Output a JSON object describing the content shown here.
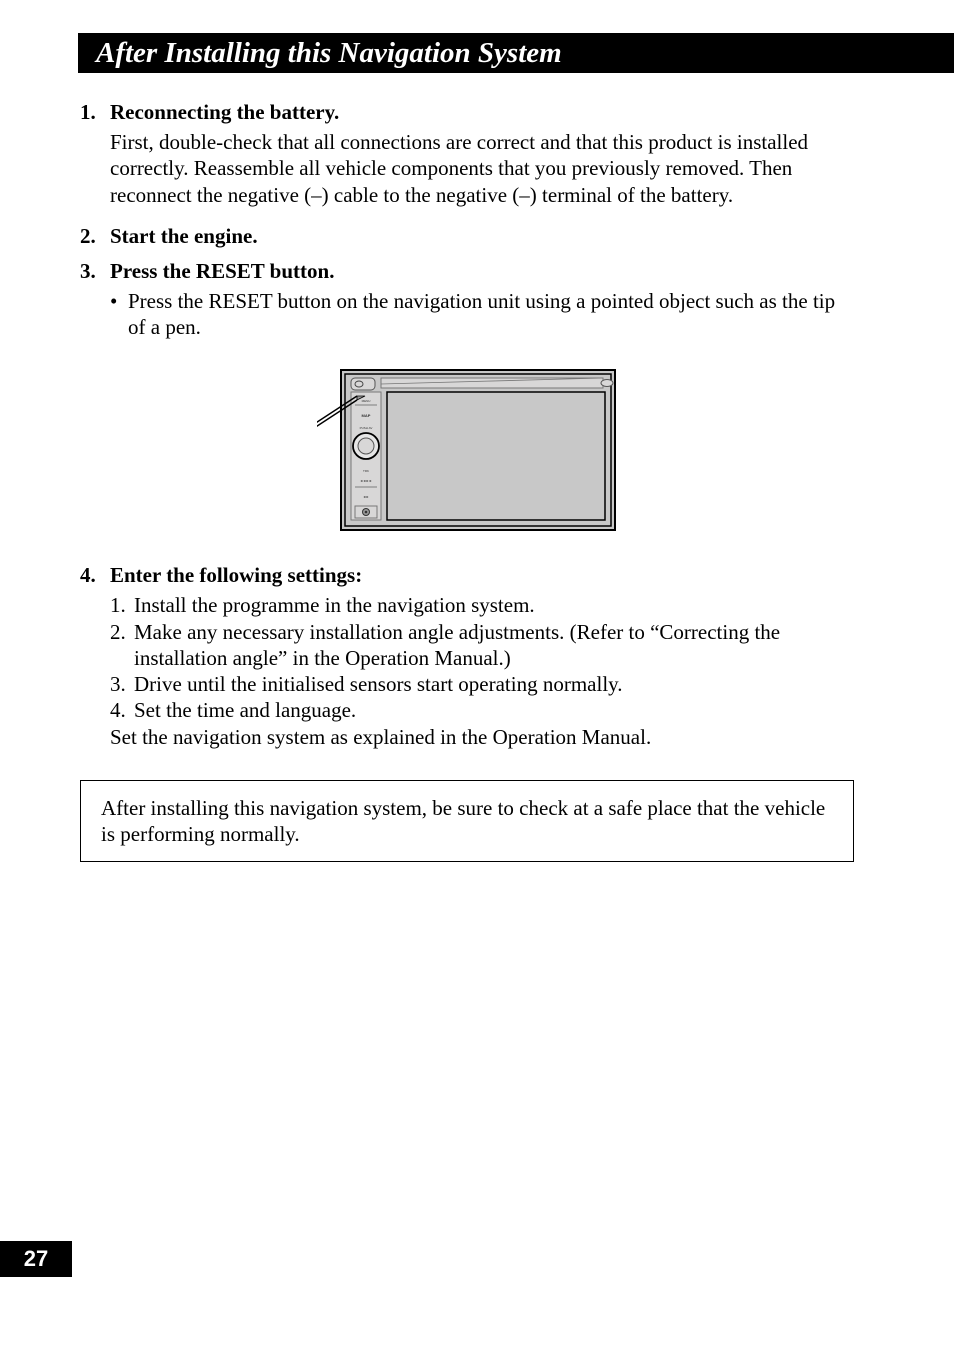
{
  "title": "After Installing this Navigation System",
  "steps": [
    {
      "num": "1.",
      "title": "Reconnecting the battery.",
      "para": "First, double-check that all connections are correct and that this product is installed correctly. Reassemble all vehicle components that you previously removed. Then reconnect the negative (–) cable to the negative (–) terminal of the battery."
    },
    {
      "num": "2.",
      "title": "Start the engine."
    },
    {
      "num": "3.",
      "title": "Press the RESET button.",
      "bullet": "Press the RESET button on the navigation unit using a pointed object such as the tip of a pen."
    },
    {
      "num": "4.",
      "title": "Enter the following settings:",
      "subitems": [
        {
          "n": "1.",
          "t": "Install the programme in the navigation system."
        },
        {
          "n": "2.",
          "t": "Make any necessary installation angle adjustments. (Refer to “Correcting the installation angle” in the Operation Manual.)"
        },
        {
          "n": "3.",
          "t": "Drive until the initialised sensors start operating normally."
        },
        {
          "n": "4.",
          "t": "Set the time and language."
        }
      ],
      "tail": "Set the navigation system as explained in the Operation Manual."
    }
  ],
  "note": "After installing this navigation system, be sure to check at a safe place that the vehicle is performing normally.",
  "page_number": "27",
  "device_labels": {
    "menu": "MENU",
    "map": "MAP",
    "pushav": "PUSH AV",
    "trk": "TRK"
  }
}
